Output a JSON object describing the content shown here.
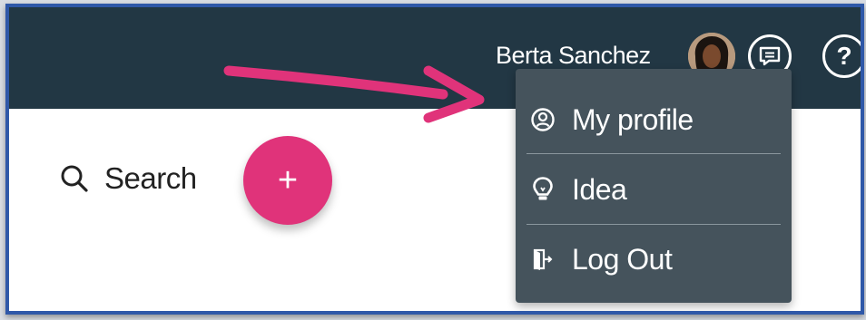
{
  "header": {
    "user_name": "Berta Sanchez",
    "help_label": "?"
  },
  "toolbar": {
    "search_label": "Search",
    "add_label": "+"
  },
  "user_menu": {
    "items": [
      {
        "label": "My profile",
        "icon": "user-circle-icon"
      },
      {
        "label": "Idea",
        "icon": "lightbulb-icon"
      },
      {
        "label": "Log Out",
        "icon": "logout-door-icon"
      }
    ]
  },
  "colors": {
    "header_bg": "#223744",
    "menu_bg": "#45535c",
    "accent": "#e0337a",
    "frame_border": "#2f58a8"
  }
}
